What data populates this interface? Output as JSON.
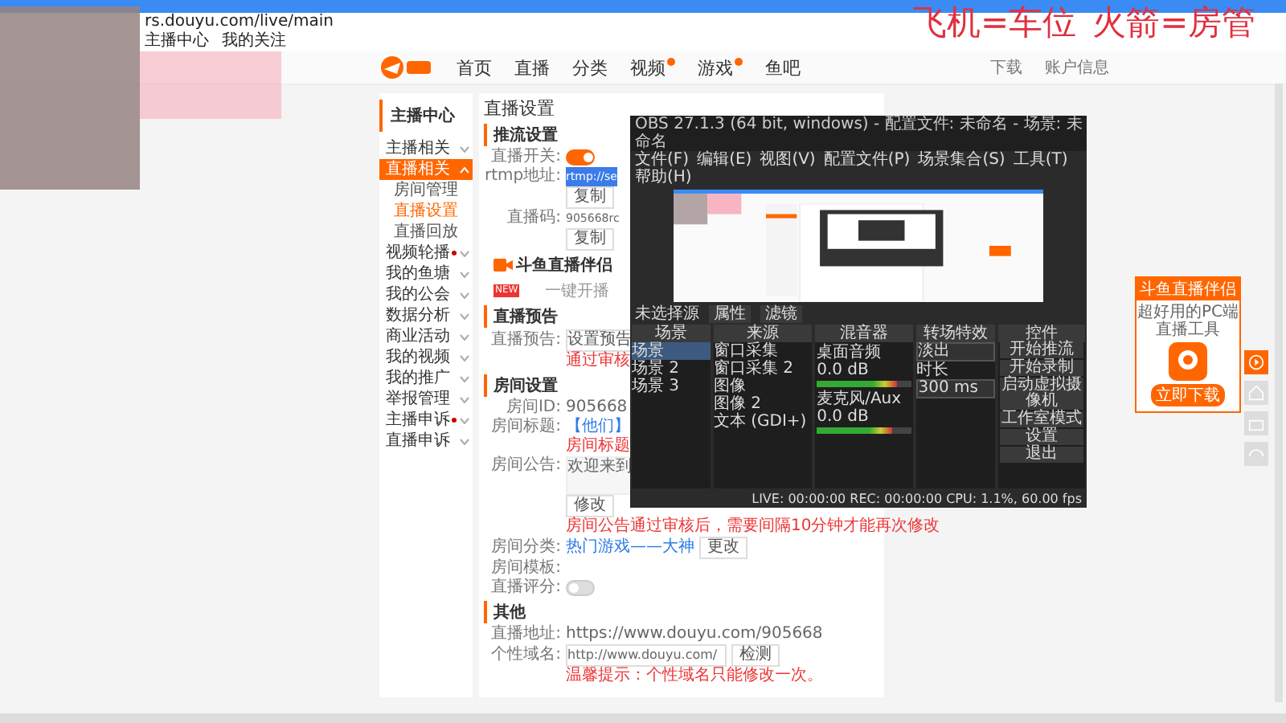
{
  "browser": {
    "address": "rs.douyu.com/live/main",
    "bookmarks": [
      "主播中心",
      "我的关注"
    ]
  },
  "overlay_text": [
    "飞机=车位",
    "火箭=房管"
  ],
  "site": {
    "nav": [
      {
        "label": "首页",
        "badge": false
      },
      {
        "label": "直播",
        "badge": false
      },
      {
        "label": "分类",
        "badge": false
      },
      {
        "label": "视频",
        "badge": true
      },
      {
        "label": "游戏",
        "badge": true
      },
      {
        "label": "鱼吧",
        "badge": false
      }
    ],
    "download": "下载",
    "user": "账户信息"
  },
  "sidebar": {
    "title": "主播中心",
    "items": [
      {
        "label": "主播相关",
        "selected": false,
        "expanded": false,
        "dot": false
      },
      {
        "label": "直播相关",
        "selected": true,
        "expanded": true,
        "dot": false,
        "children": [
          {
            "label": "房间管理",
            "selected": false
          },
          {
            "label": "直播设置",
            "selected": true
          },
          {
            "label": "直播回放",
            "selected": false
          }
        ]
      },
      {
        "label": "视频轮播",
        "selected": false,
        "expanded": false,
        "dot": true
      },
      {
        "label": "我的鱼塘",
        "selected": false,
        "expanded": false,
        "dot": false
      },
      {
        "label": "我的公会",
        "selected": false,
        "expanded": false,
        "dot": false
      },
      {
        "label": "数据分析",
        "selected": false,
        "expanded": false,
        "dot": false
      },
      {
        "label": "商业活动",
        "selected": false,
        "expanded": false,
        "dot": false
      },
      {
        "label": "我的视频",
        "selected": false,
        "expanded": false,
        "dot": false
      },
      {
        "label": "我的推广",
        "selected": false,
        "expanded": false,
        "dot": false
      },
      {
        "label": "举报管理",
        "selected": false,
        "expanded": false,
        "dot": false
      },
      {
        "label": "主播申诉",
        "selected": false,
        "expanded": false,
        "dot": true
      },
      {
        "label": "直播申诉",
        "selected": false,
        "expanded": false,
        "dot": false
      }
    ]
  },
  "content": {
    "title": "直播设置",
    "push": {
      "title": "推流设置",
      "switch_label": "直播开关:",
      "switch_on": true,
      "rtmp_label": "rtmp地址:",
      "rtmp_value": "rtmp://se",
      "copy": "复制",
      "code_label": "直播码:",
      "code_value": "905668rc",
      "copy2": "复制",
      "promo_title": "斗鱼直播伴侣",
      "promo_badge": "NEW",
      "promo_sub": "一键开播"
    },
    "preview": {
      "title": "直播预告",
      "label": "直播预告:",
      "button": "设置预告",
      "note": "通过审核"
    },
    "room": {
      "title": "房间设置",
      "id_label": "房间ID:",
      "id_value": "905668",
      "title_label": "房间标题:",
      "title_value": "【他们】",
      "title_note": "房间标题",
      "notice_label": "房间公告:",
      "notice_value": "欢迎来到",
      "modify": "修改",
      "notice_note": "房间公告通过审核后，需要间隔10分钟才能再次修改",
      "cat_label": "房间分类:",
      "cat_value": "热门游戏——大神",
      "change": "更改",
      "tpl_label": "房间模板:",
      "rate_label": "直播评分:",
      "rate_on": false
    },
    "other": {
      "title": "其他",
      "addr_label": "直播地址:",
      "addr_value": "https://www.douyu.com/905668",
      "domain_label": "个性域名:",
      "domain_value": "http://www.douyu.com/",
      "domain_button": "检测",
      "domain_note": "温馨提示：个性域名只能修改一次。"
    }
  },
  "ad": {
    "title": "斗鱼直播伴侣",
    "sub": "超好用的PC端直播工具",
    "button": "立即下载"
  },
  "obs": {
    "title": "OBS 27.1.3 (64 bit, windows) - 配置文件: 未命名 - 场景: 未命名",
    "menu": [
      "文件(F)",
      "编辑(E)",
      "视图(V)",
      "配置文件(P)",
      "场景集合(S)",
      "工具(T)",
      "帮助(H)"
    ],
    "scene_label": "未选择源",
    "props": "属性",
    "filters": "滤镜",
    "docks": [
      "场景",
      "来源",
      "混音器",
      "转场特效",
      "控件"
    ],
    "scenes": [
      {
        "label": "场景",
        "selected": true
      },
      {
        "label": "场景 2",
        "selected": false
      },
      {
        "label": "场景 3",
        "selected": false
      }
    ],
    "sources": [
      "窗口采集",
      "窗口采集 2",
      "图像",
      "图像 2",
      "文本 (GDI+)"
    ],
    "mixer": [
      {
        "name": "桌面音频",
        "reading": "0.0 dB",
        "level": 0.85
      },
      {
        "name": "麦克风/Aux",
        "reading": "0.0 dB",
        "level": 0.8
      }
    ],
    "transition": {
      "value": "淡出",
      "duration_label": "时长",
      "duration": "300 ms"
    },
    "controls": [
      "开始推流",
      "开始录制",
      "启动虚拟摄像机",
      "工作室模式",
      "设置",
      "退出"
    ],
    "status": "LIVE: 00:00:00   REC: 00:00:00   CPU: 1.1%, 60.00 fps"
  }
}
